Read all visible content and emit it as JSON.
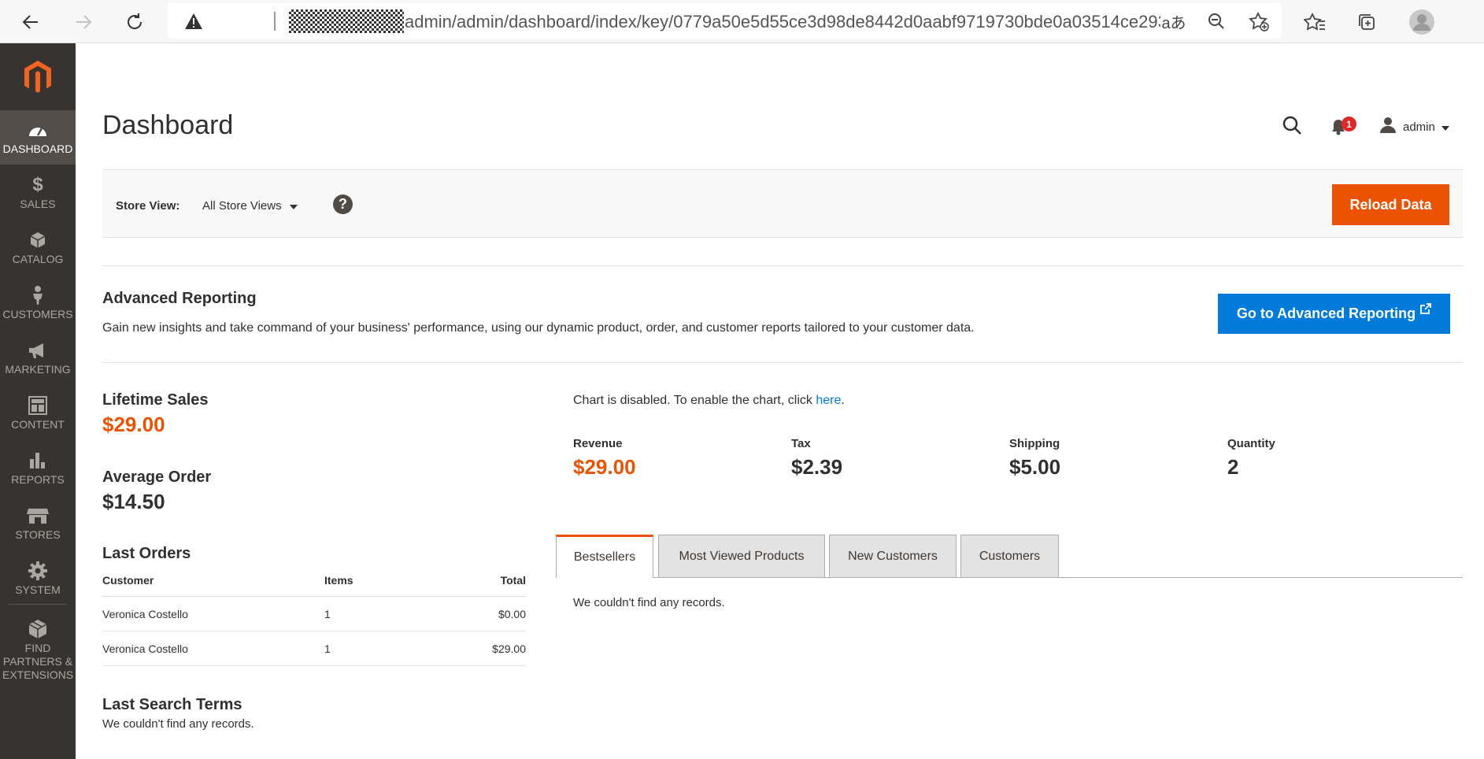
{
  "browser": {
    "url": "admin/admin/dashboard/index/key/0779a50e5d55ce3d98de8442d0aabf9719730bde0a03514ce293...",
    "icons": [
      "back-icon",
      "forward-icon",
      "refresh-icon",
      "warning-icon",
      "read-aloud-icon",
      "zoom-out-icon",
      "add-favorite-icon",
      "favorites-icon",
      "collections-icon",
      "profile-icon"
    ]
  },
  "sidebar": {
    "items": [
      {
        "label": "DASHBOARD",
        "icon": "dashboard-icon",
        "active": true
      },
      {
        "label": "SALES",
        "icon": "dollar-icon"
      },
      {
        "label": "CATALOG",
        "icon": "cube-icon"
      },
      {
        "label": "CUSTOMERS",
        "icon": "person-icon"
      },
      {
        "label": "MARKETING",
        "icon": "megaphone-icon"
      },
      {
        "label": "CONTENT",
        "icon": "layout-icon"
      },
      {
        "label": "REPORTS",
        "icon": "bar-chart-icon"
      },
      {
        "label": "STORES",
        "icon": "store-icon"
      },
      {
        "label": "SYSTEM",
        "icon": "gear-icon"
      },
      {
        "label": "FIND PARTNERS & EXTENSIONS",
        "icon": "extensions-icon"
      }
    ]
  },
  "header": {
    "title": "Dashboard",
    "notification_count": "1",
    "user": "admin"
  },
  "store_switcher": {
    "label": "Store View:",
    "selected": "All Store Views",
    "reload_label": "Reload Data"
  },
  "advanced_reporting": {
    "title": "Advanced Reporting",
    "description": "Gain new insights and take command of your business' performance, using our dynamic product, order, and customer reports tailored to your customer data.",
    "button_label": "Go to Advanced Reporting"
  },
  "stats": {
    "lifetime_sales_label": "Lifetime Sales",
    "lifetime_sales_value": "$29.00",
    "average_order_label": "Average Order",
    "average_order_value": "$14.50"
  },
  "last_orders": {
    "title": "Last Orders",
    "columns": [
      "Customer",
      "Items",
      "Total"
    ],
    "rows": [
      {
        "customer": "Veronica Costello",
        "items": "1",
        "total": "$0.00"
      },
      {
        "customer": "Veronica Costello",
        "items": "1",
        "total": "$29.00"
      }
    ]
  },
  "last_search": {
    "title": "Last Search Terms",
    "empty": "We couldn't find any records."
  },
  "chart": {
    "disabled_text": "Chart is disabled. To enable the chart, click ",
    "link_text": "here",
    "period": "."
  },
  "totals": [
    {
      "label": "Revenue",
      "value": "$29.00"
    },
    {
      "label": "Tax",
      "value": "$2.39"
    },
    {
      "label": "Shipping",
      "value": "$5.00"
    },
    {
      "label": "Quantity",
      "value": "2"
    }
  ],
  "tabs": {
    "items": [
      "Bestsellers",
      "Most Viewed Products",
      "New Customers",
      "Customers"
    ],
    "empty": "We couldn't find any records."
  },
  "colors": {
    "accent": "#eb5202",
    "link": "#007bdb",
    "sidebar_bg": "#373330"
  }
}
